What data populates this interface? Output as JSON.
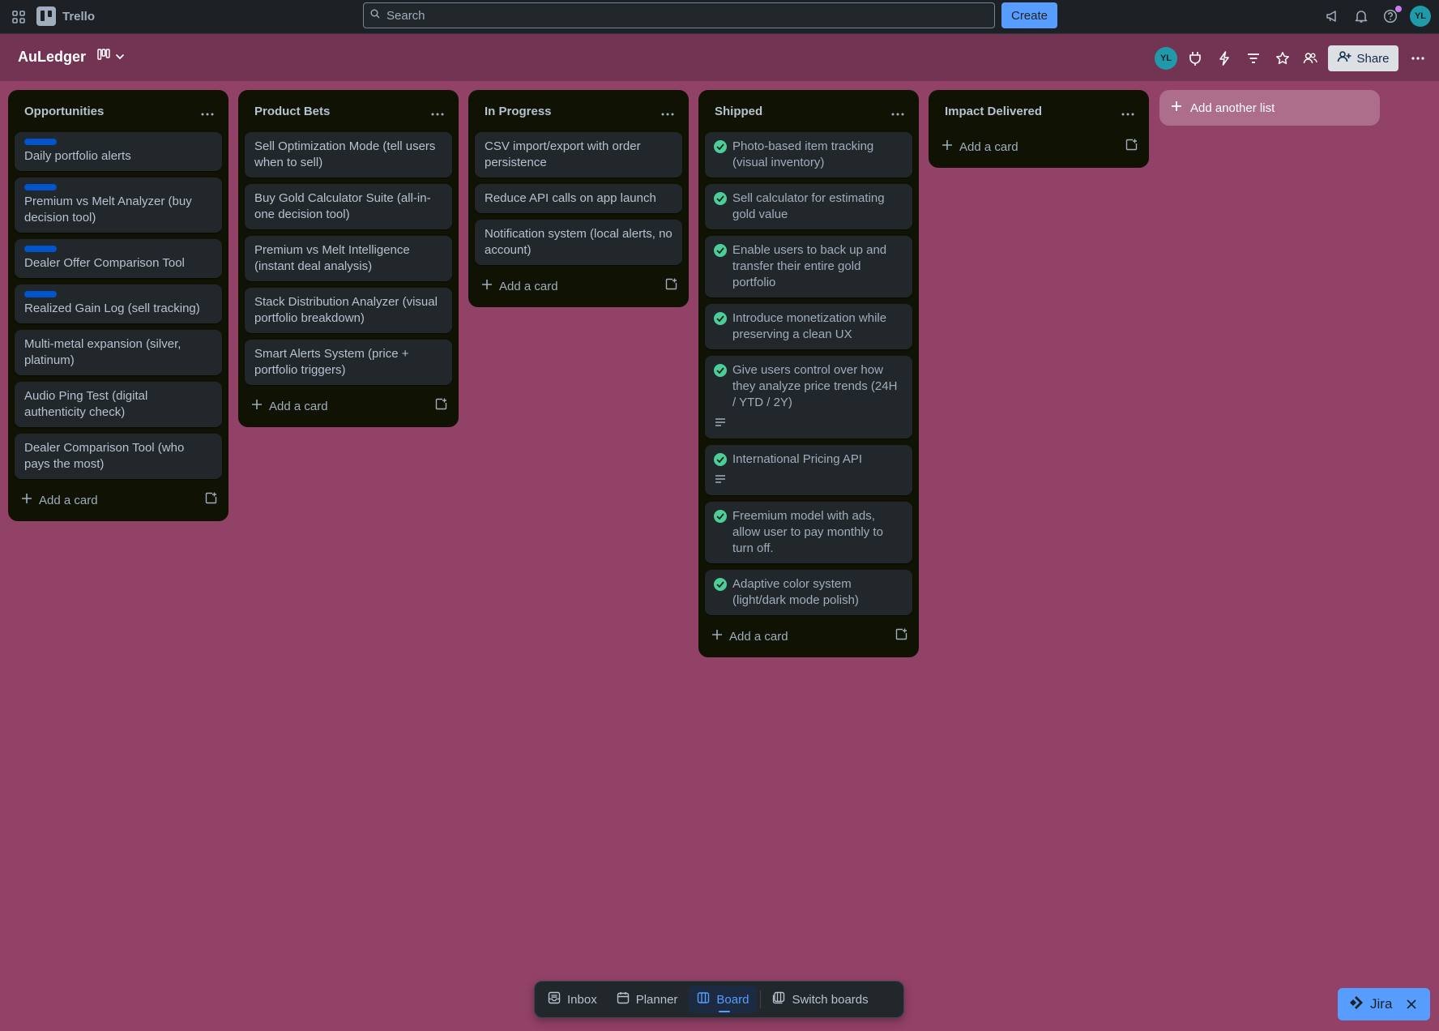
{
  "topbar": {
    "apps_icon": "grid-icon",
    "logo_text": "Trello",
    "search_placeholder": "Search",
    "create_label": "Create",
    "avatar_initials": "YL",
    "icons": [
      "megaphone-icon",
      "bell-icon",
      "help-icon"
    ]
  },
  "board": {
    "title": "AuLedger",
    "member_initials": "YL",
    "share_label": "Share"
  },
  "lists": [
    {
      "title": "Opportunities",
      "cards": [
        {
          "title": "Daily portfolio alerts",
          "label": true,
          "done": false,
          "desc": false
        },
        {
          "title": "Premium vs Melt Analyzer (buy decision tool)",
          "label": true,
          "done": false,
          "desc": false
        },
        {
          "title": "Dealer Offer Comparison Tool",
          "label": true,
          "done": false,
          "desc": false
        },
        {
          "title": "Realized Gain Log (sell tracking)",
          "label": true,
          "done": false,
          "desc": false
        },
        {
          "title": "Multi-metal expansion (silver, platinum)",
          "label": false,
          "done": false,
          "desc": false
        },
        {
          "title": "Audio Ping Test (digital authenticity check)",
          "label": false,
          "done": false,
          "desc": false
        },
        {
          "title": "Dealer Comparison Tool (who pays the most)",
          "label": false,
          "done": false,
          "desc": false
        }
      ],
      "add_label": "Add a card"
    },
    {
      "title": "Product Bets",
      "cards": [
        {
          "title": "Sell Optimization Mode (tell users when to sell)",
          "label": false,
          "done": false,
          "desc": false
        },
        {
          "title": "Buy Gold Calculator Suite (all-in-one decision tool)",
          "label": false,
          "done": false,
          "desc": false
        },
        {
          "title": "Premium vs Melt Intelligence (instant deal analysis)",
          "label": false,
          "done": false,
          "desc": false
        },
        {
          "title": "Stack Distribution Analyzer (visual portfolio breakdown)",
          "label": false,
          "done": false,
          "desc": false
        },
        {
          "title": "Smart Alerts System (price + portfolio triggers)",
          "label": false,
          "done": false,
          "desc": false
        }
      ],
      "add_label": "Add a card"
    },
    {
      "title": "In Progress",
      "cards": [
        {
          "title": "CSV import/export with order persistence",
          "label": false,
          "done": false,
          "desc": false
        },
        {
          "title": "Reduce API calls on app launch",
          "label": false,
          "done": false,
          "desc": false
        },
        {
          "title": "Notification system (local alerts, no account)",
          "label": false,
          "done": false,
          "desc": false
        }
      ],
      "add_label": "Add a card"
    },
    {
      "title": "Shipped",
      "cards": [
        {
          "title": "Photo-based item tracking (visual inventory)",
          "label": false,
          "done": true,
          "desc": false
        },
        {
          "title": "Sell calculator for estimating gold value",
          "label": false,
          "done": true,
          "desc": false
        },
        {
          "title": "Enable users to back up and transfer their entire gold portfolio",
          "label": false,
          "done": true,
          "desc": false
        },
        {
          "title": "Introduce monetization while preserving a clean UX",
          "label": false,
          "done": true,
          "desc": false
        },
        {
          "title": "Give users control over how they analyze price trends (24H / YTD / 2Y)",
          "label": false,
          "done": true,
          "desc": true
        },
        {
          "title": "International Pricing API",
          "label": false,
          "done": true,
          "desc": true
        },
        {
          "title": "Freemium model with ads, allow user to pay monthly to turn off.",
          "label": false,
          "done": true,
          "desc": false
        },
        {
          "title": "Adaptive color system (light/dark mode polish)",
          "label": false,
          "done": true,
          "desc": false
        }
      ],
      "add_label": "Add a card"
    },
    {
      "title": "Impact Delivered",
      "cards": [],
      "add_label": "Add a card"
    }
  ],
  "add_list_label": "Add another list",
  "bottom_nav": {
    "inbox": "Inbox",
    "planner": "Planner",
    "board": "Board",
    "switch": "Switch boards"
  },
  "jira_label": "Jira",
  "colors": {
    "background": "#924167",
    "header": "#733352",
    "label_blue": "#0055cc",
    "check_green": "#4bce97",
    "accent": "#579dff"
  }
}
